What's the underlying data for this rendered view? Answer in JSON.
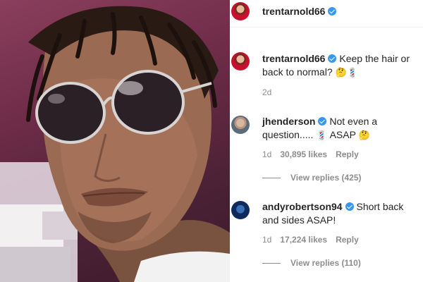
{
  "post": {
    "author": "trentarnold66",
    "caption": "Keep the hair or back to normal?",
    "caption_emoji": "🤔💈",
    "age": "2d"
  },
  "comments": [
    {
      "username": "jhenderson",
      "text": "Not even a question.....",
      "emoji_mid": "💈",
      "text_tail": "ASAP",
      "emoji_end": "🤔",
      "age": "1d",
      "likes": "30,895 likes",
      "reply_label": "Reply",
      "view_replies": "View replies (425)"
    },
    {
      "username": "andyrobertson94",
      "text": "Short back and sides ASAP!",
      "age": "1d",
      "likes": "17,224 likes",
      "reply_label": "Reply",
      "view_replies": "View replies (110)"
    }
  ],
  "icons": {
    "verified": "verified-badge-icon"
  },
  "colors": {
    "verified_blue": "#3897f0",
    "muted_text": "#8e8e8e"
  }
}
